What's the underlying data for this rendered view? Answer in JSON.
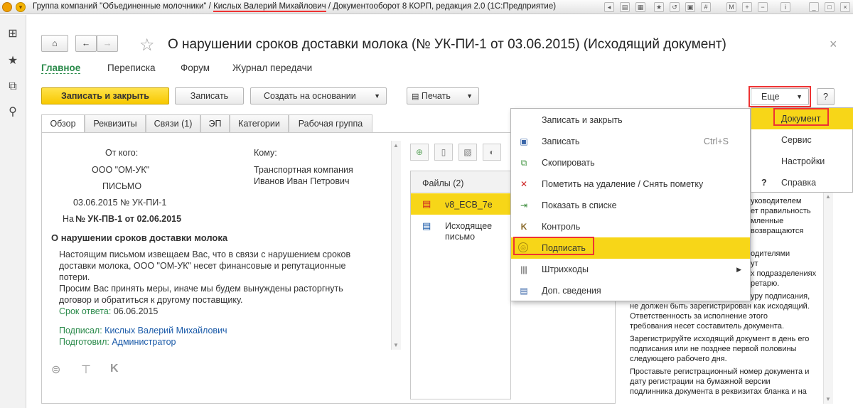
{
  "titlebar": {
    "app_prefix": "Группа компаний \"Объединенные молочники\" /",
    "user": "Кислых Валерий Михайлович",
    "app_suffix": "/ Документооборот 8 КОРП, редакция 2.0  (1С:Предприятие)"
  },
  "header": {
    "title": "О нарушении сроков доставки молока (№ УК-ПИ-1 от 03.06.2015) (Исходящий документ)"
  },
  "nav_tabs": [
    "Главное",
    "Переписка",
    "Форум",
    "Журнал передачи"
  ],
  "toolbar": {
    "save_close": "Записать и закрыть",
    "save": "Записать",
    "create_based": "Создать на основании",
    "print": "Печать",
    "more": "Еще",
    "help": "?"
  },
  "sub_tabs": [
    "Обзор",
    "Реквизиты",
    "Связи (1)",
    "ЭП",
    "Категории",
    "Рабочая группа"
  ],
  "overview": {
    "from_label": "От кого:",
    "to_label": "Кому:",
    "from_org": "ООО \"ОМ-УК\"",
    "from_type": "ПИСЬМО",
    "from_reg": "03.06.2015 № УК-ПИ-1",
    "to_org": "Транспортная компания",
    "to_person": "Иванов Иван Петрович",
    "in_reply_prefix": "На",
    "in_reply_link": "№ УК-ПВ-1 от 02.06.2015",
    "subject": "О нарушении сроков доставки молока",
    "body_1": "Настоящим письмом извещаем Вас, что в связи с нарушением сроков",
    "body_2": "доставки молока, ООО \"ОМ-УК\" несет финансовые и репутационные",
    "body_3": "потери.",
    "body_4": "Просим Вас принять меры, иначе мы будем вынуждены расторгнуть",
    "body_5": "договор и обратиться к другому поставщику.",
    "deadline_label": "Срок ответа:",
    "deadline_value": "06.06.2015",
    "signed_label": "Подписал:",
    "signed_value": "Кислых Валерий Михайлович",
    "prepared_label": "Подготовил:",
    "prepared_value": "Администратор"
  },
  "files": {
    "header": "Файлы (2)",
    "items": [
      "v8_ECB_7e",
      "Исходящее письмо"
    ]
  },
  "more_menu": {
    "items": [
      {
        "label": "Записать и закрыть",
        "shortcut": "",
        "icon": ""
      },
      {
        "label": "Записать",
        "shortcut": "Ctrl+S",
        "icon": "save-icon"
      },
      {
        "label": "Скопировать",
        "shortcut": "",
        "icon": "copy-icon"
      },
      {
        "label": "Пометить на удаление / Снять пометку",
        "shortcut": "",
        "icon": "delete-mark-icon"
      },
      {
        "label": "Показать в списке",
        "shortcut": "",
        "icon": "show-in-list-icon"
      },
      {
        "label": "Контроль",
        "shortcut": "",
        "icon": "control-icon"
      },
      {
        "label": "Подписать",
        "shortcut": "",
        "icon": "sign-icon"
      },
      {
        "label": "Штрихкоды",
        "shortcut": "",
        "icon": "barcode-icon"
      },
      {
        "label": "Доп. сведения",
        "shortcut": "",
        "icon": "additional-info-icon"
      }
    ],
    "submenu": [
      "Документ",
      "Сервис",
      "Настройки",
      "Справка"
    ],
    "highlight_color": "#f7d618"
  },
  "right_panel": {
    "lines_top": [
      "уководителем",
      "ет правильность",
      "мленные",
      "возвращаются"
    ],
    "lines_mid": [
      "одителями",
      "ут",
      "х подразделениях",
      "ретарю."
    ],
    "para_1": [
      "уру подписания,",
      "не должен быть зарегистрирован как исходящий.",
      "Ответственность за исполнение этого",
      "требования несет составитель документа."
    ],
    "para_2": [
      "Зарегистрируйте исходящий документ в день его",
      "подписания или не позднее первой половины",
      "следующего рабочего дня."
    ],
    "para_3": [
      "Проставьте регистрационный номер документа и",
      "дату регистрации на бумажной версии",
      "подлинника документа в реквизитах бланка и на"
    ]
  }
}
